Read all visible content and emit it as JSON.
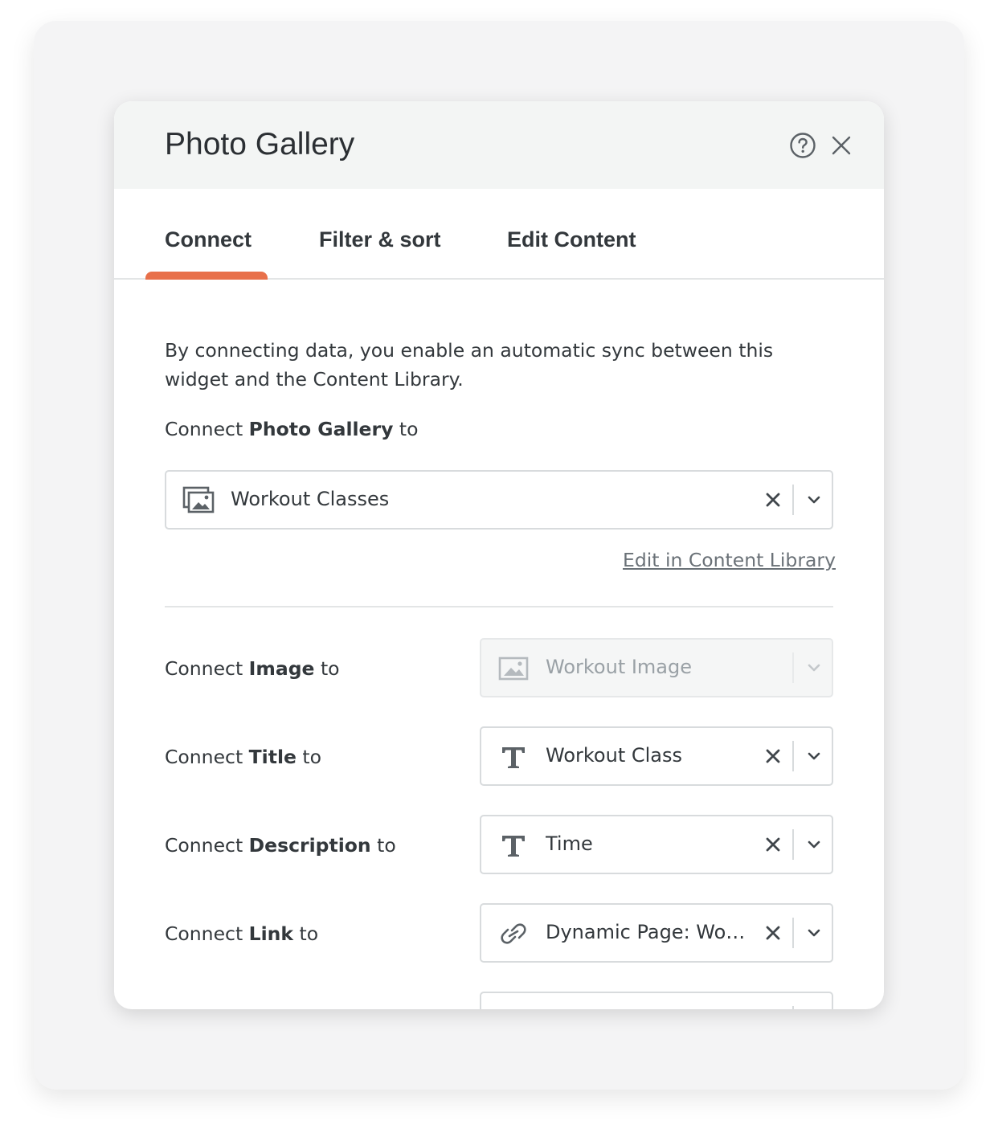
{
  "dialog": {
    "title": "Photo Gallery",
    "help_icon": "help-circle-icon",
    "close_icon": "close-icon"
  },
  "tabs": [
    {
      "label": "Connect",
      "active": true
    },
    {
      "label": "Filter & sort",
      "active": false
    },
    {
      "label": "Edit Content",
      "active": false
    }
  ],
  "colors": {
    "accent": "#e8704a",
    "header_bg": "#f3f5f4",
    "text": "#33383c",
    "muted": "#9aa1a6"
  },
  "connect": {
    "intro": "By connecting data, you enable an automatic sync between this widget and the Content Library.",
    "main_label_prefix": "Connect ",
    "main_label_bold": "Photo Gallery",
    "main_label_suffix": " to",
    "main_select": {
      "icon": "gallery-icon",
      "value": "Workout Classes"
    },
    "edit_link": "Edit in Content Library"
  },
  "fields": [
    {
      "prefix": "Connect ",
      "bold": "Image",
      "suffix": " to",
      "icon": "image-icon",
      "value": "Workout Image",
      "disabled": true
    },
    {
      "prefix": "Connect ",
      "bold": "Title",
      "suffix": " to",
      "icon": "text-icon",
      "value": "Workout Class",
      "disabled": false
    },
    {
      "prefix": "Connect ",
      "bold": "Description",
      "suffix": " to",
      "icon": "text-icon",
      "value": "Time",
      "disabled": false
    },
    {
      "prefix": "Connect ",
      "bold": "Link",
      "suffix": " to",
      "icon": "link-icon",
      "value": "Dynamic Page: Wo…",
      "disabled": false
    }
  ]
}
